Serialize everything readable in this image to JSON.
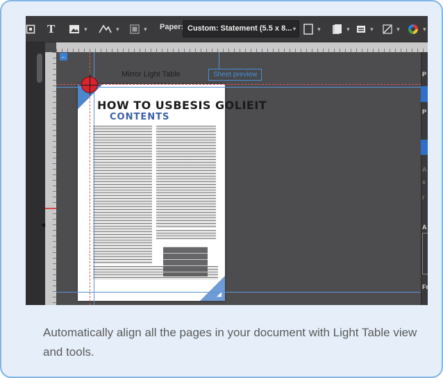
{
  "toolbar": {
    "paper_label": "Paper:",
    "paper_value": "Custom: Statement (5.5 x 8...",
    "text_tool_glyph": "T"
  },
  "canvas": {
    "title": "Mirror Light Table",
    "sheet_preview_label": "Sheet preview",
    "back_glyph": "←"
  },
  "page": {
    "title": "HOW TO USBESIS GOLIEIT",
    "subtitle": "CONTENTS"
  },
  "right_panel": {
    "letters": [
      "P",
      "P",
      "A",
      "x",
      "r",
      "A",
      "Fr"
    ]
  },
  "caption": "Automatically align all the pages in your document with Light Table view and tools.",
  "colors": {
    "card_bg": "#e6eff9",
    "card_border": "#7fb6e6",
    "guide_blue": "#5b93d6",
    "guide_red": "#e05252",
    "accent_blue": "#2f6fc9",
    "crosshair_red": "#d8242e"
  },
  "icons": [
    "frame-icon",
    "text-icon",
    "image-icon",
    "sign-icon",
    "layout-icon",
    "page-outline-icon",
    "document-icon",
    "layers-icon",
    "slash-icon",
    "color-wheel-icon"
  ]
}
